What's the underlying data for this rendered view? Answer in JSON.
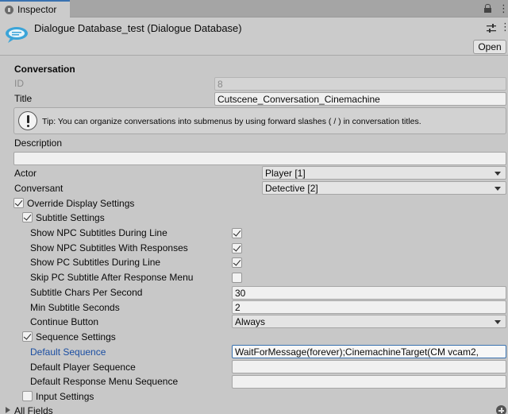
{
  "tab": {
    "label": "Inspector"
  },
  "header": {
    "title": "Dialogue Database_test (Dialogue Database)",
    "open_button": "Open"
  },
  "section_title": "Conversation",
  "fields": {
    "id": {
      "label": "ID",
      "value": "8"
    },
    "title": {
      "label": "Title",
      "value": "Cutscene_Conversation_Cinemachine"
    },
    "tip": "Tip: You can organize conversations into submenus by using forward slashes ( / ) in conversation titles.",
    "description": {
      "label": "Description",
      "value": ""
    },
    "actor": {
      "label": "Actor",
      "value": "Player [1]"
    },
    "conversant": {
      "label": "Conversant",
      "value": "Detective [2]"
    }
  },
  "override": {
    "label": "Override Display Settings",
    "checked": true
  },
  "subtitle_settings": {
    "label": "Subtitle Settings",
    "checked": true,
    "items": {
      "npc_during": {
        "label": "Show NPC Subtitles During Line",
        "checked": true
      },
      "npc_with_responses": {
        "label": "Show NPC Subtitles With Responses",
        "checked": true
      },
      "pc_during": {
        "label": "Show PC Subtitles During Line",
        "checked": true
      },
      "skip_pc": {
        "label": "Skip PC Subtitle After Response Menu",
        "checked": false
      },
      "chars_per_second": {
        "label": "Subtitle Chars Per Second",
        "value": "30"
      },
      "min_seconds": {
        "label": "Min Subtitle Seconds",
        "value": "2"
      },
      "continue_button": {
        "label": "Continue Button",
        "value": "Always"
      }
    }
  },
  "sequence_settings": {
    "label": "Sequence Settings",
    "checked": true,
    "default_sequence": {
      "label": "Default Sequence",
      "value": "WaitForMessage(forever);CinemachineTarget(CM vcam2,"
    },
    "default_player_sequence": {
      "label": "Default Player Sequence",
      "value": ""
    },
    "default_response_menu_sequence": {
      "label": "Default Response Menu Sequence",
      "value": ""
    }
  },
  "input_settings": {
    "label": "Input Settings",
    "checked": false
  },
  "all_fields": {
    "label": "All Fields"
  },
  "icons": [
    "inspector-icon",
    "lock-icon",
    "kebab-menu-icon",
    "dialogue-database-icon",
    "sliders-icon",
    "warning-icon",
    "foldout-arrow-icon",
    "plus-icon"
  ]
}
